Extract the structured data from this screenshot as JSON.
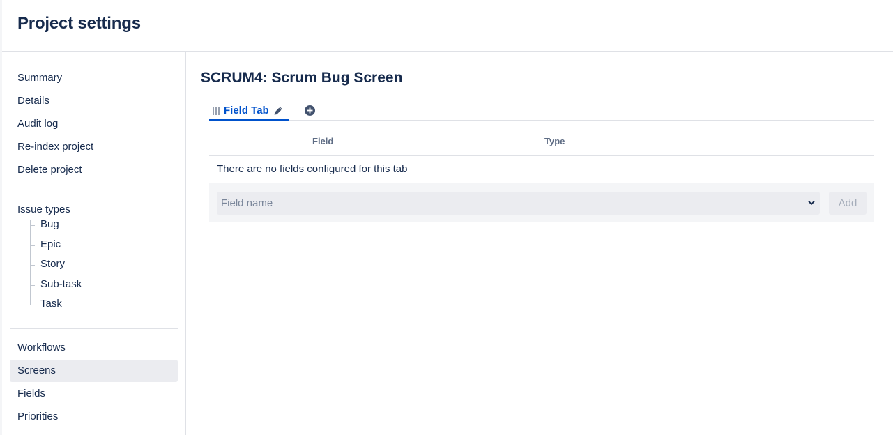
{
  "header": {
    "title": "Project settings"
  },
  "sidebar": {
    "top_items": [
      "Summary",
      "Details",
      "Audit log",
      "Re-index project",
      "Delete project"
    ],
    "issue_types_label": "Issue types",
    "issue_types": [
      "Bug",
      "Epic",
      "Story",
      "Sub-task",
      "Task"
    ],
    "bottom_items": [
      "Workflows",
      "Screens",
      "Fields",
      "Priorities"
    ],
    "active_item": "Screens"
  },
  "main": {
    "screen_title": "SCRUM4: Scrum Bug Screen",
    "tab": {
      "label": "Field Tab",
      "edit_icon": "pencil-icon",
      "add_icon": "add-circle-icon"
    },
    "table": {
      "columns": [
        "Field",
        "Type"
      ],
      "empty_message": "There are no fields configured for this tab"
    },
    "add_field": {
      "placeholder": "Field name",
      "chevron_icon": "chevron-down-icon",
      "button_label": "Add"
    }
  },
  "colors": {
    "accent": "#0052cc",
    "text": "#172b4d",
    "subtle_text": "#5e6c84",
    "active_bg": "#ebecf0",
    "border": "#dfe1e6"
  }
}
